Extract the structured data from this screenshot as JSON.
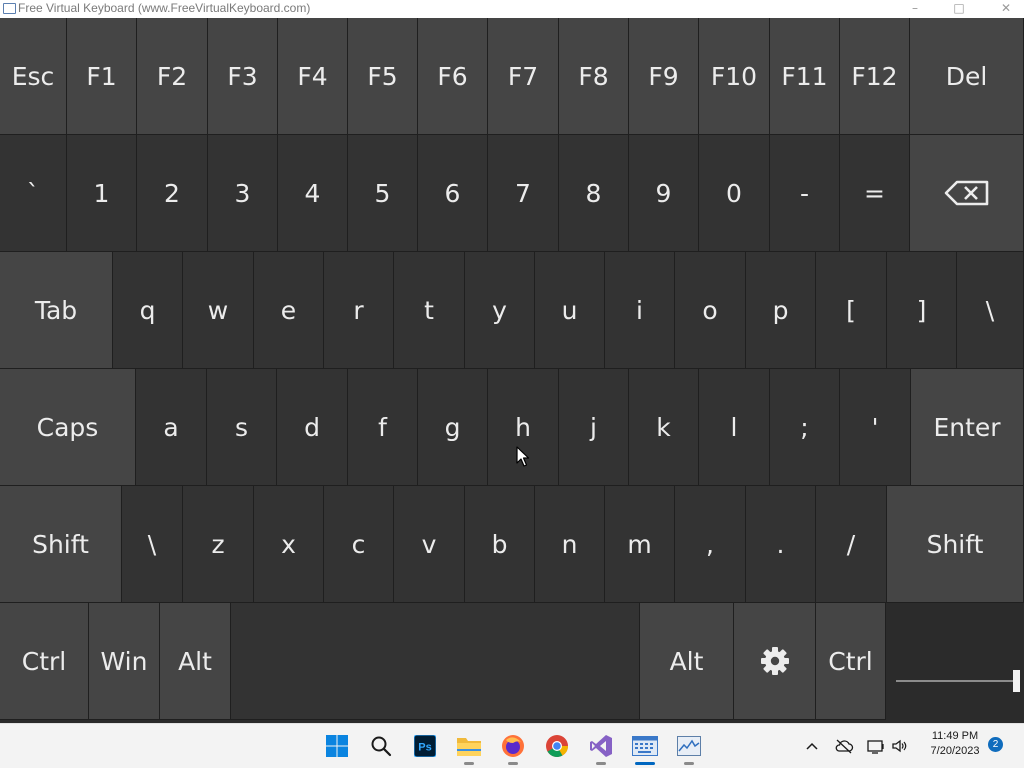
{
  "window": {
    "title": "Free Virtual Keyboard (www.FreeVirtualKeyboard.com)",
    "minimize_glyph": "–",
    "maximize_glyph": "□",
    "close_glyph": "✕",
    "app_icon": "keyboard-icon"
  },
  "keyboard": {
    "colors": {
      "light_key": "#454545",
      "dark_key": "#333333",
      "text": "#ececec"
    },
    "rows": [
      {
        "name": "function-row",
        "keys": [
          {
            "id": "esc",
            "label": "Esc"
          },
          {
            "id": "f1",
            "label": "F1"
          },
          {
            "id": "f2",
            "label": "F2"
          },
          {
            "id": "f3",
            "label": "F3"
          },
          {
            "id": "f4",
            "label": "F4"
          },
          {
            "id": "f5",
            "label": "F5"
          },
          {
            "id": "f6",
            "label": "F6"
          },
          {
            "id": "f7",
            "label": "F7"
          },
          {
            "id": "f8",
            "label": "F8"
          },
          {
            "id": "f9",
            "label": "F9"
          },
          {
            "id": "f10",
            "label": "F10"
          },
          {
            "id": "f11",
            "label": "F11"
          },
          {
            "id": "f12",
            "label": "F12"
          },
          {
            "id": "del",
            "label": "Del"
          }
        ]
      },
      {
        "name": "number-row",
        "keys": [
          {
            "id": "backtick",
            "label": "`"
          },
          {
            "id": "1",
            "label": "1"
          },
          {
            "id": "2",
            "label": "2"
          },
          {
            "id": "3",
            "label": "3"
          },
          {
            "id": "4",
            "label": "4"
          },
          {
            "id": "5",
            "label": "5"
          },
          {
            "id": "6",
            "label": "6"
          },
          {
            "id": "7",
            "label": "7"
          },
          {
            "id": "8",
            "label": "8"
          },
          {
            "id": "9",
            "label": "9"
          },
          {
            "id": "0",
            "label": "0"
          },
          {
            "id": "minus",
            "label": "-"
          },
          {
            "id": "equals",
            "label": "="
          },
          {
            "id": "backspace",
            "label": "",
            "icon": "backspace-icon"
          }
        ]
      },
      {
        "name": "top-letter-row",
        "keys": [
          {
            "id": "tab",
            "label": "Tab"
          },
          {
            "id": "q",
            "label": "q"
          },
          {
            "id": "w",
            "label": "w"
          },
          {
            "id": "e",
            "label": "e"
          },
          {
            "id": "r",
            "label": "r"
          },
          {
            "id": "t",
            "label": "t"
          },
          {
            "id": "y",
            "label": "y"
          },
          {
            "id": "u",
            "label": "u"
          },
          {
            "id": "i",
            "label": "i"
          },
          {
            "id": "o",
            "label": "o"
          },
          {
            "id": "p",
            "label": "p"
          },
          {
            "id": "lbracket",
            "label": "["
          },
          {
            "id": "rbracket",
            "label": "]"
          },
          {
            "id": "backslash",
            "label": "\\"
          }
        ]
      },
      {
        "name": "home-row",
        "keys": [
          {
            "id": "caps",
            "label": "Caps"
          },
          {
            "id": "a",
            "label": "a"
          },
          {
            "id": "s",
            "label": "s"
          },
          {
            "id": "d",
            "label": "d"
          },
          {
            "id": "f",
            "label": "f"
          },
          {
            "id": "g",
            "label": "g"
          },
          {
            "id": "h",
            "label": "h"
          },
          {
            "id": "j",
            "label": "j"
          },
          {
            "id": "k",
            "label": "k"
          },
          {
            "id": "l",
            "label": "l"
          },
          {
            "id": "semicolon",
            "label": ";"
          },
          {
            "id": "quote",
            "label": "'"
          },
          {
            "id": "enter",
            "label": "Enter"
          }
        ]
      },
      {
        "name": "bottom-letter-row",
        "keys": [
          {
            "id": "lshift",
            "label": "Shift"
          },
          {
            "id": "backslash2",
            "label": "\\"
          },
          {
            "id": "z",
            "label": "z"
          },
          {
            "id": "x",
            "label": "x"
          },
          {
            "id": "c",
            "label": "c"
          },
          {
            "id": "v",
            "label": "v"
          },
          {
            "id": "b",
            "label": "b"
          },
          {
            "id": "n",
            "label": "n"
          },
          {
            "id": "m",
            "label": "m"
          },
          {
            "id": "comma",
            "label": ","
          },
          {
            "id": "period",
            "label": "."
          },
          {
            "id": "slash",
            "label": "/"
          },
          {
            "id": "rshift",
            "label": "Shift"
          }
        ]
      },
      {
        "name": "modifier-row",
        "keys": [
          {
            "id": "lctrl",
            "label": "Ctrl"
          },
          {
            "id": "win",
            "label": "Win"
          },
          {
            "id": "lalt",
            "label": "Alt"
          },
          {
            "id": "space",
            "label": ""
          },
          {
            "id": "ralt",
            "label": "Alt"
          },
          {
            "id": "settings",
            "label": "",
            "icon": "gear-icon"
          },
          {
            "id": "rctrl",
            "label": "Ctrl"
          }
        ]
      }
    ],
    "opacity_slider": {
      "value": 1.0
    }
  },
  "taskbar": {
    "apps": [
      {
        "id": "start",
        "icon": "windows-start-icon",
        "running": false,
        "active": false
      },
      {
        "id": "search",
        "icon": "search-icon",
        "running": false,
        "active": false
      },
      {
        "id": "photoshop",
        "icon": "photoshop-icon",
        "label": "Ps",
        "running": false,
        "active": false
      },
      {
        "id": "explorer",
        "icon": "folder-icon",
        "running": true,
        "active": false
      },
      {
        "id": "firefox",
        "icon": "firefox-icon",
        "running": true,
        "active": false
      },
      {
        "id": "chrome",
        "icon": "chrome-icon",
        "running": false,
        "active": false
      },
      {
        "id": "visualstudio",
        "icon": "visual-studio-icon",
        "running": true,
        "active": false
      },
      {
        "id": "virtualkeyboard",
        "icon": "keyboard-app-icon",
        "running": true,
        "active": true
      },
      {
        "id": "monitor",
        "icon": "performance-monitor-icon",
        "running": true,
        "active": false
      }
    ],
    "tray": {
      "icons": [
        "chevron-up-icon",
        "cloud-offline-icon",
        "network-icon",
        "volume-icon"
      ],
      "time": "11:49 PM",
      "date": "7/20/2023",
      "notification_count": "2"
    }
  }
}
